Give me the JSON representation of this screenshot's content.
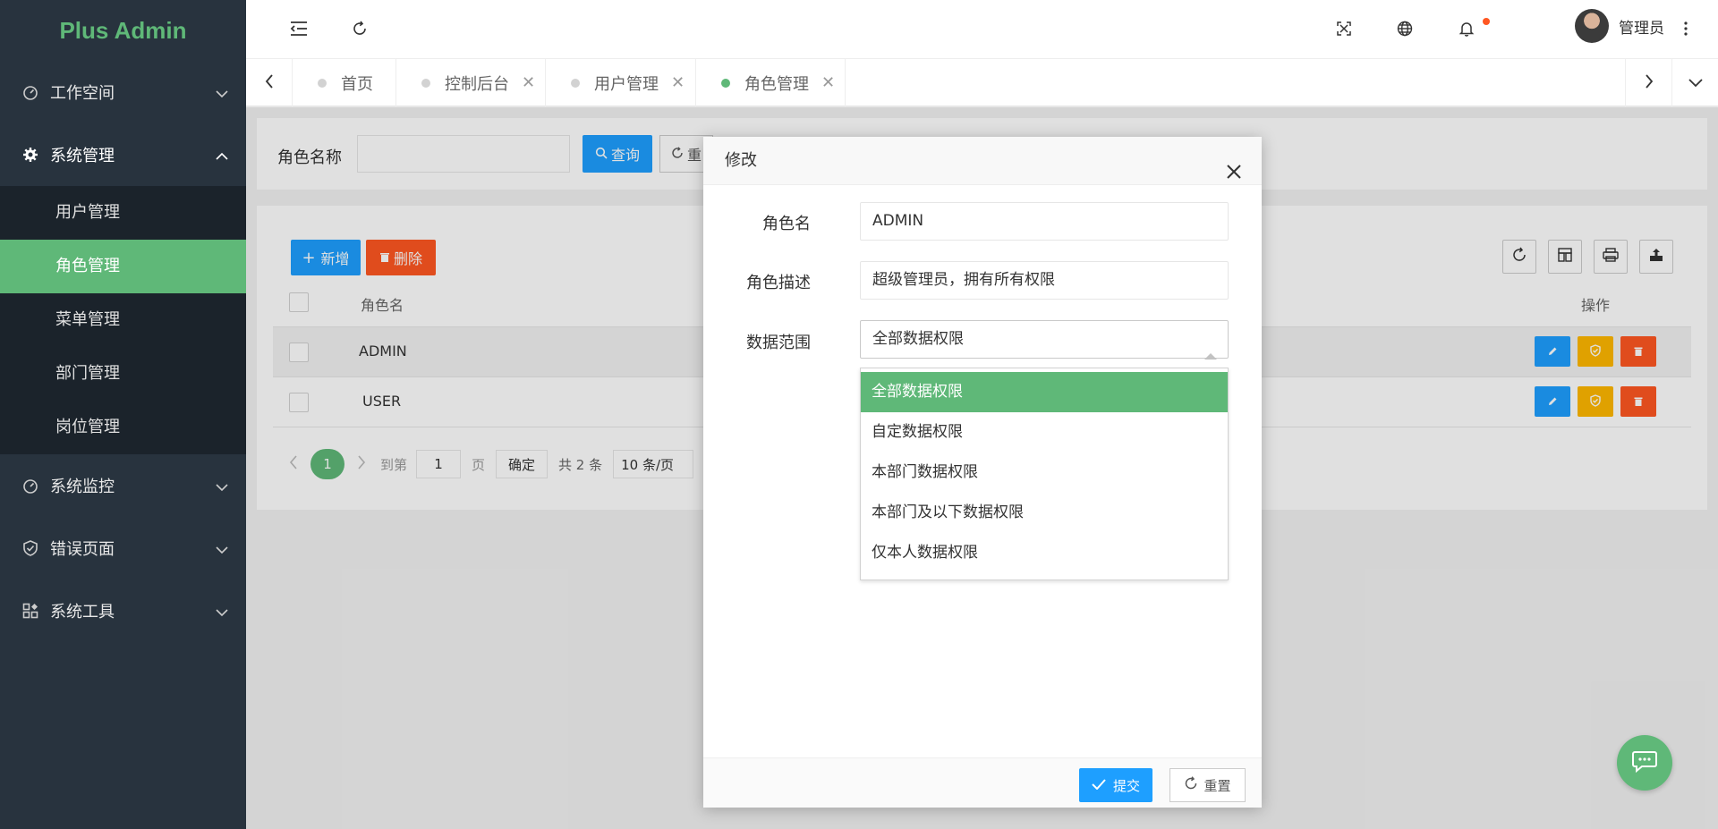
{
  "app": {
    "logo": "Plus Admin"
  },
  "sidebar": {
    "groups": [
      {
        "label": "工作空间",
        "icon": "dashboard-icon"
      },
      {
        "label": "系统管理",
        "icon": "gear-icon",
        "expanded": true
      },
      {
        "label": "系统监控",
        "icon": "dashboard-icon"
      },
      {
        "label": "错误页面",
        "icon": "shield-icon"
      },
      {
        "label": "系统工具",
        "icon": "apps-icon"
      }
    ],
    "sub_items": [
      {
        "label": "用户管理"
      },
      {
        "label": "角色管理",
        "active": true
      },
      {
        "label": "菜单管理"
      },
      {
        "label": "部门管理"
      },
      {
        "label": "岗位管理"
      }
    ]
  },
  "header": {
    "user_name": "管理员"
  },
  "tabs": [
    {
      "label": "首页"
    },
    {
      "label": "控制后台"
    },
    {
      "label": "用户管理"
    },
    {
      "label": "角色管理",
      "active": true
    }
  ],
  "search": {
    "label": "角色名称",
    "query_button": "查询",
    "reset_button": "重"
  },
  "toolbar": {
    "add_button": "新增",
    "delete_button": "删除"
  },
  "table": {
    "headers": {
      "role_name": "角色名",
      "actions": "操作"
    },
    "rows": [
      {
        "role_name": "ADMIN"
      },
      {
        "role_name": "USER"
      }
    ]
  },
  "pager": {
    "current": "1",
    "goto_label": "到第",
    "page_value": "1",
    "page_unit": "页",
    "confirm": "确定",
    "total": "共 2 条",
    "page_size": "10 条/页"
  },
  "modal": {
    "title": "修改",
    "fields": {
      "role_name_label": "角色名",
      "role_name_value": "ADMIN",
      "desc_label": "角色描述",
      "desc_value": "超级管理员，拥有所有权限",
      "scope_label": "数据范围",
      "scope_value": "全部数据权限"
    },
    "scope_options": [
      "全部数据权限",
      "自定数据权限",
      "本部门数据权限",
      "本部门及以下数据权限",
      "仅本人数据权限"
    ],
    "submit_button": "提交",
    "reset_button": "重置"
  },
  "colors": {
    "brand_green": "#5fb878",
    "sidebar_bg": "#28333e",
    "blue": "#1e9fff",
    "red": "#ff5722",
    "orange": "#ffb800"
  }
}
